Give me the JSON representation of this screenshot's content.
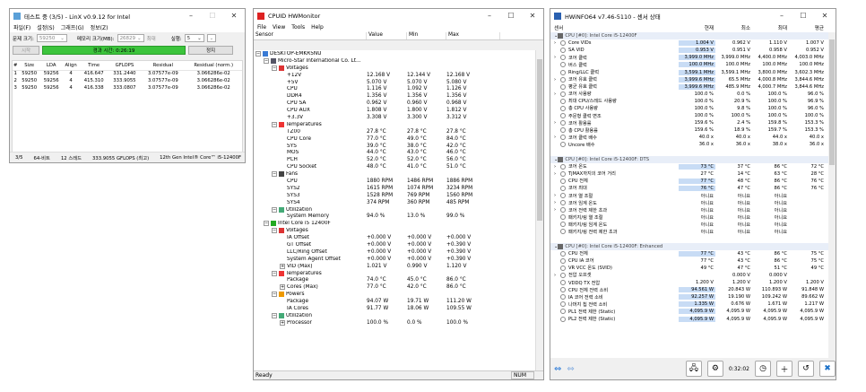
{
  "linx": {
    "title": "테스트 중 (3/5) - LinX v0.9.12 for Intel",
    "menu": [
      "파일(F)",
      "설정(S)",
      "그래프(G)",
      "정보(Z)"
    ],
    "problem_label": "문제 크기:",
    "problem_value": "59250",
    "mem_label": "메모리 크기(MB):",
    "mem_value": "26829",
    "max_label": "최대",
    "runs_label": "실행:",
    "runs_value": "5",
    "start_btn": "시작",
    "elapsed": "경과 시간: 0:26:19",
    "stop_btn": "정지",
    "headers": [
      "#",
      "Size",
      "LDA",
      "Align",
      "Time",
      "GFLOPS",
      "Residual",
      "Residual (norm.)"
    ],
    "rows": [
      [
        "1",
        "59250",
        "59256",
        "4",
        "416.647",
        "331.2440",
        "3.07577e-09",
        "3.066286e-02"
      ],
      [
        "2",
        "59250",
        "59256",
        "4",
        "415.310",
        "333.9055",
        "3.07577e-09",
        "3.066286e-02"
      ],
      [
        "3",
        "59250",
        "59256",
        "4",
        "416.338",
        "333.0807",
        "3.07577e-09",
        "3.066286e-02"
      ]
    ],
    "status": [
      "3/5",
      "64-비트",
      "12 스레드",
      "333.9055 GFLOPS (최고)",
      "12th Gen Intel® Core™ i5-12400F"
    ]
  },
  "hwm": {
    "title": "CPUID HWMonitor",
    "menu": [
      "File",
      "View",
      "Tools",
      "Help"
    ],
    "headers": [
      "Sensor",
      "Value",
      "Min",
      "Max"
    ],
    "status_left": "Ready",
    "status_right": "NUM",
    "rows": [
      {
        "d": 0,
        "t": "g",
        "n": "DESKTOP-EMKR5NU",
        "i": "pc"
      },
      {
        "d": 1,
        "t": "g",
        "n": "Micro-Star International Co. Lt...",
        "i": "board"
      },
      {
        "d": 2,
        "t": "g",
        "n": "Voltages",
        "i": "volt"
      },
      {
        "d": 3,
        "n": "+12V",
        "v": [
          "12.168 V",
          "12.144 V",
          "12.168 V"
        ]
      },
      {
        "d": 3,
        "n": "+5V",
        "v": [
          "5.070 V",
          "5.070 V",
          "5.080 V"
        ]
      },
      {
        "d": 3,
        "n": "CPU",
        "v": [
          "1.116 V",
          "1.092 V",
          "1.126 V"
        ]
      },
      {
        "d": 3,
        "n": "DDR4",
        "v": [
          "1.356 V",
          "1.356 V",
          "1.356 V"
        ]
      },
      {
        "d": 3,
        "n": "CPU SA",
        "v": [
          "0.962 V",
          "0.960 V",
          "0.968 V"
        ]
      },
      {
        "d": 3,
        "n": "CPU AUX",
        "v": [
          "1.808 V",
          "1.800 V",
          "1.812 V"
        ]
      },
      {
        "d": 3,
        "n": "+3.3V",
        "v": [
          "3.308 V",
          "3.300 V",
          "3.312 V"
        ]
      },
      {
        "d": 2,
        "t": "g",
        "n": "Temperatures",
        "i": "temp"
      },
      {
        "d": 3,
        "n": "TZ00",
        "v": [
          "27.8 °C",
          "27.8 °C",
          "27.8 °C"
        ]
      },
      {
        "d": 3,
        "n": "CPU Core",
        "v": [
          "77.0 °C",
          "49.0 °C",
          "84.0 °C"
        ]
      },
      {
        "d": 3,
        "n": "SYS",
        "v": [
          "39.0 °C",
          "38.0 °C",
          "42.0 °C"
        ]
      },
      {
        "d": 3,
        "n": "MOS",
        "v": [
          "44.0 °C",
          "43.0 °C",
          "46.0 °C"
        ]
      },
      {
        "d": 3,
        "n": "PCH",
        "v": [
          "52.0 °C",
          "52.0 °C",
          "56.0 °C"
        ]
      },
      {
        "d": 3,
        "n": "CPU Socket",
        "v": [
          "48.0 °C",
          "41.0 °C",
          "51.0 °C"
        ]
      },
      {
        "d": 2,
        "t": "g",
        "n": "Fans",
        "i": "fan"
      },
      {
        "d": 3,
        "n": "CPU",
        "v": [
          "1880 RPM",
          "1486 RPM",
          "1886 RPM"
        ]
      },
      {
        "d": 3,
        "n": "SYS2",
        "v": [
          "1615 RPM",
          "1074 RPM",
          "3234 RPM"
        ]
      },
      {
        "d": 3,
        "n": "SYS3",
        "v": [
          "1528 RPM",
          "769 RPM",
          "1560 RPM"
        ]
      },
      {
        "d": 3,
        "n": "SYS4",
        "v": [
          "374 RPM",
          "360 RPM",
          "485 RPM"
        ]
      },
      {
        "d": 2,
        "t": "g",
        "n": "Utilization",
        "i": "util"
      },
      {
        "d": 3,
        "n": "System Memory",
        "v": [
          "94.0 %",
          "13.0 %",
          "99.0 %"
        ]
      },
      {
        "d": 1,
        "t": "g",
        "n": "Intel Core i5 12400F",
        "i": "chip"
      },
      {
        "d": 2,
        "t": "g",
        "n": "Voltages",
        "i": "volt"
      },
      {
        "d": 3,
        "n": "IA Offset",
        "v": [
          "+0.000 V",
          "+0.000 V",
          "+0.000 V"
        ]
      },
      {
        "d": 3,
        "n": "GT Offset",
        "v": [
          "+0.000 V",
          "+0.000 V",
          "+0.390 V"
        ]
      },
      {
        "d": 3,
        "n": "LLC/Ring Offset",
        "v": [
          "+0.000 V",
          "+0.000 V",
          "+0.390 V"
        ]
      },
      {
        "d": 3,
        "n": "System Agent Offset",
        "v": [
          "+0.000 V",
          "+0.000 V",
          "+0.390 V"
        ]
      },
      {
        "d": 3,
        "t": "e",
        "n": "VID (Max)",
        "v": [
          "1.021 V",
          "0.990 V",
          "1.120 V"
        ]
      },
      {
        "d": 2,
        "t": "g",
        "n": "Temperatures",
        "i": "temp"
      },
      {
        "d": 3,
        "n": "Package",
        "v": [
          "74.0 °C",
          "45.0 °C",
          "86.0 °C"
        ]
      },
      {
        "d": 3,
        "t": "e",
        "n": "Cores (Max)",
        "v": [
          "77.0 °C",
          "42.0 °C",
          "86.0 °C"
        ]
      },
      {
        "d": 2,
        "t": "g",
        "n": "Powers",
        "i": "pow"
      },
      {
        "d": 3,
        "n": "Package",
        "v": [
          "94.07 W",
          "19.71 W",
          "111.20 W"
        ]
      },
      {
        "d": 3,
        "n": "IA Cores",
        "v": [
          "91.77 W",
          "18.06 W",
          "109.55 W"
        ]
      },
      {
        "d": 2,
        "t": "g",
        "n": "Utilization",
        "i": "util"
      },
      {
        "d": 3,
        "t": "e",
        "n": "Processor",
        "v": [
          "100.0 %",
          "0.0 %",
          "100.0 %"
        ]
      }
    ]
  },
  "hwi": {
    "title": "HWiNFO64 v7.46-5110 - 센서 상태",
    "headers": [
      "센서",
      "현재",
      "최소",
      "최대",
      "평균"
    ],
    "time": "0:32:02",
    "rows": [
      {
        "g": "CPU [#0]: Intel Core i5-12400F"
      },
      {
        "n": "Core VIDs",
        "v": [
          "1.004 V",
          "0.962 V",
          "1.110 V",
          "1.007 V"
        ],
        "h": 1,
        "x": 1
      },
      {
        "n": "SA VID",
        "v": [
          "0.953 V",
          "0.951 V",
          "0.958 V",
          "0.952 V"
        ],
        "h": 1
      },
      {
        "n": "코어 클럭",
        "v": [
          "3,999.0 MHz",
          "3,999.0 MHz",
          "4,400.0 MHz",
          "4,003.0 MHz"
        ],
        "h": 1,
        "x": 1
      },
      {
        "n": "버스 클럭",
        "v": [
          "100.0 MHz",
          "100.0 MHz",
          "100.0 MHz",
          "100.0 MHz"
        ],
        "h": 1
      },
      {
        "n": "Ring/LLC 클럭",
        "v": [
          "3,599.1 MHz",
          "3,599.1 MHz",
          "3,800.0 MHz",
          "3,602.3 MHz"
        ],
        "h": 1
      },
      {
        "n": "코어 유효 클럭",
        "v": [
          "3,999.6 MHz",
          "65.5 MHz",
          "4,000.8 MHz",
          "3,844.6 MHz"
        ],
        "h": 1,
        "x": 1
      },
      {
        "n": "평균 유효 클럭",
        "v": [
          "3,999.6 MHz",
          "485.9 MHz",
          "4,000.7 MHz",
          "3,844.6 MHz"
        ],
        "h": 1
      },
      {
        "n": "코어 사용량",
        "v": [
          "100.0 %",
          "0.0 %",
          "100.0 %",
          "96.0 %"
        ],
        "x": 1
      },
      {
        "n": "최대 CPU/스레드 사용량",
        "v": [
          "100.0 %",
          "20.9 %",
          "100.0 %",
          "96.9 %"
        ]
      },
      {
        "n": "총 CPU 사용량",
        "v": [
          "100.0 %",
          "9.8 %",
          "100.0 %",
          "96.0 %"
        ]
      },
      {
        "n": "주문형 클럭 변조",
        "v": [
          "100.0 %",
          "100.0 %",
          "100.0 %",
          "100.0 %"
        ]
      },
      {
        "n": "코어 활용률",
        "v": [
          "159.6 %",
          "2.4 %",
          "159.8 %",
          "153.3 %"
        ],
        "x": 1
      },
      {
        "n": "총 CPU 활용률",
        "v": [
          "159.6 %",
          "18.9 %",
          "159.7 %",
          "153.3 %"
        ]
      },
      {
        "n": "코어 클럭 배수",
        "v": [
          "40.0 x",
          "40.0 x",
          "44.0 x",
          "40.0 x"
        ],
        "x": 1
      },
      {
        "n": "Uncore 배수",
        "v": [
          "36.0 x",
          "36.0 x",
          "38.0 x",
          "36.0 x"
        ]
      },
      {
        "sp": 1
      },
      {
        "g": "CPU [#0]: Intel Core i5-12400F: DTS"
      },
      {
        "n": "코어 온도",
        "v": [
          "73 °C",
          "37 °C",
          "86 °C",
          "72 °C"
        ],
        "h": 1,
        "x": 1
      },
      {
        "n": "TjMAX까지의 코어 거리",
        "v": [
          "27 °C",
          "14 °C",
          "63 °C",
          "28 °C"
        ],
        "x": 1
      },
      {
        "n": "CPU 전체",
        "v": [
          "77 °C",
          "48 °C",
          "86 °C",
          "76 °C"
        ],
        "h": 1
      },
      {
        "n": "코어 최대",
        "v": [
          "76 °C",
          "47 °C",
          "86 °C",
          "76 °C"
        ],
        "h": 1
      },
      {
        "n": "코어 열 조절",
        "v": [
          "아니요",
          "아니요",
          "아니요",
          ""
        ],
        "x": 1
      },
      {
        "n": "코어 임계 온도",
        "v": [
          "아니요",
          "아니요",
          "아니요",
          ""
        ],
        "x": 1
      },
      {
        "n": "코어 전력 제한 초과",
        "v": [
          "아니요",
          "아니요",
          "아니요",
          ""
        ],
        "x": 1
      },
      {
        "n": "패키지/링 열 조절",
        "v": [
          "아니요",
          "아니요",
          "아니요",
          ""
        ]
      },
      {
        "n": "패키지/링 임계 온도",
        "v": [
          "아니요",
          "아니요",
          "아니요",
          ""
        ]
      },
      {
        "n": "패키지/링 전력 제한 초과",
        "v": [
          "아니요",
          "아니요",
          "아니요",
          ""
        ]
      },
      {
        "sp": 1
      },
      {
        "g": "CPU [#0]: Intel Core i5-12400F: Enhanced"
      },
      {
        "n": "CPU 전체",
        "v": [
          "77 °C",
          "43 °C",
          "86 °C",
          "75 °C"
        ],
        "h": 1
      },
      {
        "n": "CPU IA 코어",
        "v": [
          "77 °C",
          "43 °C",
          "86 °C",
          "75 °C"
        ]
      },
      {
        "n": "VR VCC 온도 (SVID)",
        "v": [
          "49 °C",
          "47 °C",
          "51 °C",
          "49 °C"
        ]
      },
      {
        "n": "전압 오프셋",
        "v": [
          "",
          "0.000 V",
          "0.000 V",
          ""
        ],
        "x": 1
      },
      {
        "n": "VDDQ TX 전압",
        "v": [
          "1.200 V",
          "1.200 V",
          "1.200 V",
          "1.200 V"
        ]
      },
      {
        "n": "CPU 전체 전력 소비",
        "v": [
          "94.561 W",
          "20.843 W",
          "110.893 W",
          "91.848 W"
        ],
        "h": 1
      },
      {
        "n": "IA 코어 전력 소비",
        "v": [
          "92.257 W",
          "19.190 W",
          "109.242 W",
          "89.662 W"
        ],
        "h": 1
      },
      {
        "n": "나머지 칩 전력 소비",
        "v": [
          "1.335 W",
          "0.676 W",
          "1.671 W",
          "1.217 W"
        ],
        "h": 1
      },
      {
        "n": "PL1 전력 제한 (Static)",
        "v": [
          "4,095.9 W",
          "4,095.9 W",
          "4,095.9 W",
          "4,095.9 W"
        ],
        "h": 1
      },
      {
        "n": "PL2 전력 제한 (Static)",
        "v": [
          "4,095.9 W",
          "4,095.9 W",
          "4,095.9 W",
          "4,095.9 W"
        ],
        "h": 1
      }
    ]
  }
}
